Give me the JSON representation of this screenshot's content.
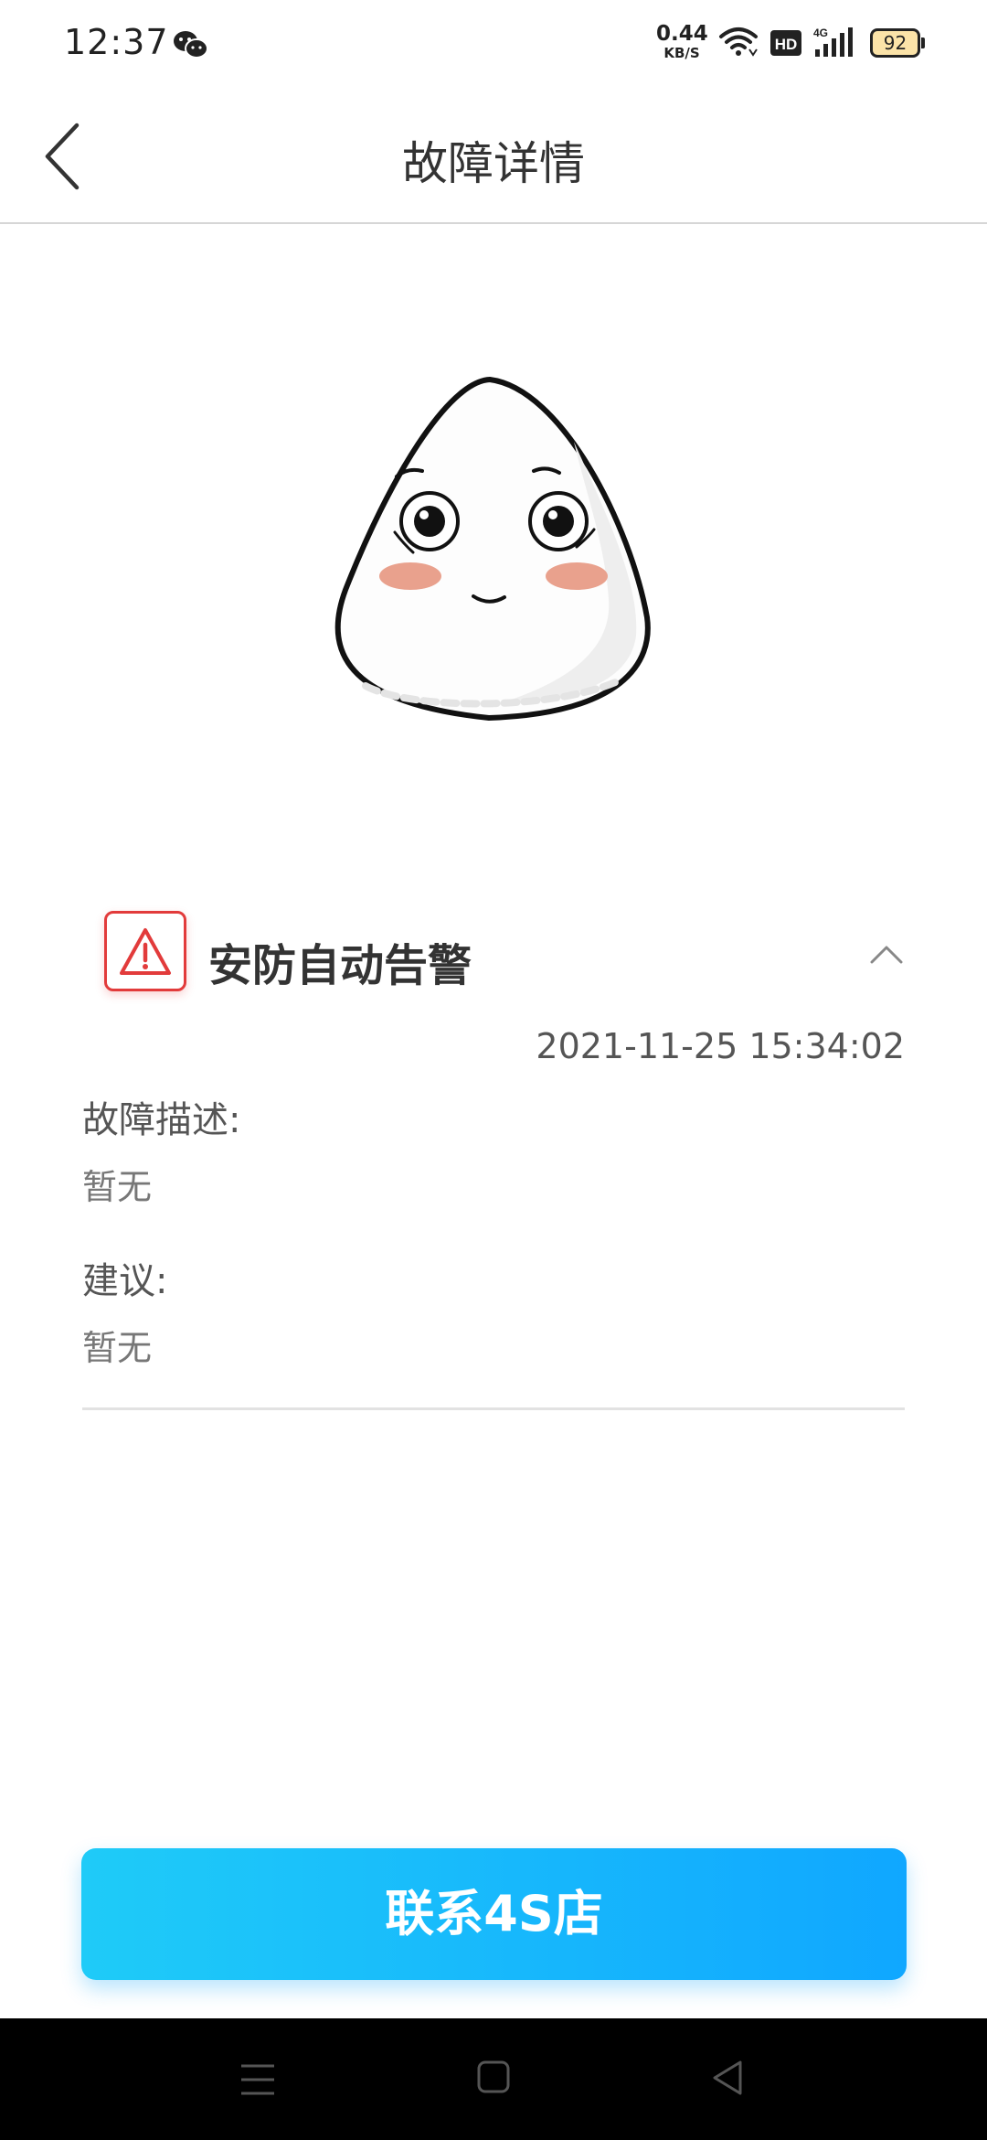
{
  "status_bar": {
    "time": "12:37",
    "net_speed_value": "0.44",
    "net_speed_unit": "KB/S",
    "hd_label": "HD",
    "network_type": "4G",
    "battery_level": "92",
    "icons": [
      "wechat-icon",
      "wifi-icon",
      "hd-icon",
      "signal-icon",
      "battery-icon"
    ]
  },
  "header": {
    "title": "故障详情",
    "back_icon": "chevron-left-icon"
  },
  "alert": {
    "title": "安防自动告警",
    "icon": "warning-icon",
    "accent_color": "#e23b3b",
    "timestamp": "2021-11-25 15:34:02",
    "description_label": "故障描述:",
    "description_value": "暂无",
    "suggestion_label": "建议:",
    "suggestion_value": "暂无"
  },
  "actions": {
    "contact_label": "联系4S店",
    "gradient_start": "#1fcbf8",
    "gradient_end": "#10a7ff"
  },
  "nav_bar": {
    "icons": [
      "menu-icon",
      "home-icon",
      "back-icon"
    ]
  }
}
